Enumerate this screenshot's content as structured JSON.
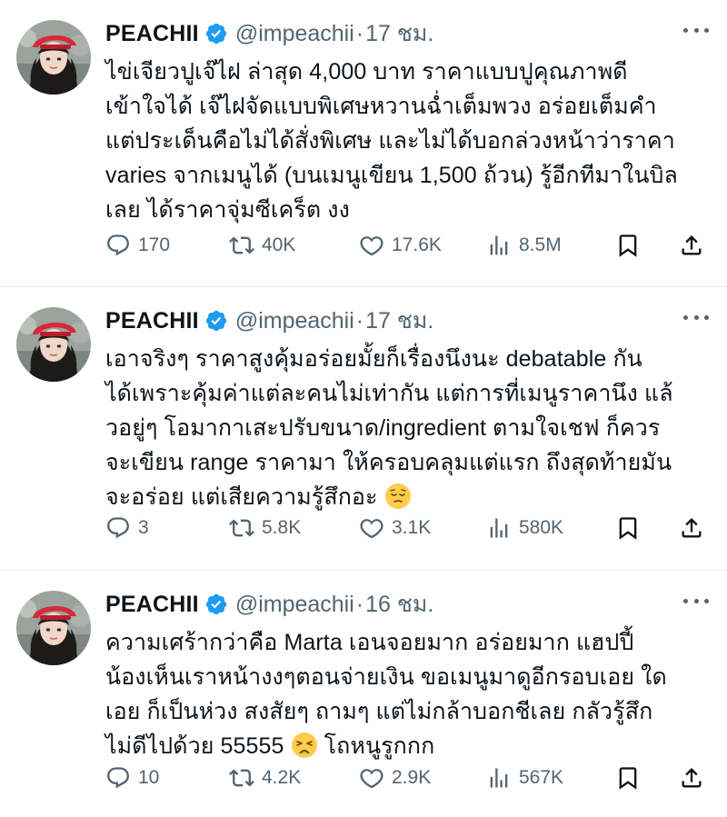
{
  "tweets": [
    {
      "name": "PEACHII",
      "handle": "@impeachii",
      "dot": "·",
      "time": "17 ชม.",
      "text": "ไข่เจียวปูเจ๊ไฝ ล่าสุด 4,000 บาท ราคาแบบปูคุณภาพดี\nเข้าใจได้ เจ๊ไฝจัดแบบพิเศษหวานฉ่ำเต็มพวง อร่อยเต็มคำ\nแต่ประเด็นคือไม่ได้สั่งพิเศษ และไม่ได้บอกล่วงหน้าว่าราคา\nvaries จากเมนูได้ (บนเมนูเขียน 1,500 ถ้วน) รู้อีกทีมาในบิล\nเลย ได้ราคาจุ่มซีเคร็ต งง",
      "replies": "170",
      "retweets": "40K",
      "likes": "17.6K",
      "views": "8.5M"
    },
    {
      "name": "PEACHII",
      "handle": "@impeachii",
      "dot": "·",
      "time": "17 ชม.",
      "text": "เอาจริงๆ ราคาสูงคุ้มอร่อยมั้ยก็เรื่องนึงนะ debatable กัน\nได้เพราะคุ้มค่าแต่ละคนไม่เท่ากัน แต่การที่เมนูราคานึง แล้\nวอยู่ๆ โอมากาเสะปรับขนาด/ingredient ตามใจเชฟ ก็ควร\nจะเขียน range ราคามา ให้ครอบคลุมแต่แรก ถึงสุดท้ายมัน\nจะอร่อย แต่เสียความรู้สึกอะ",
      "emoji": "pensive-face-emoji",
      "replies": "3",
      "retweets": "5.8K",
      "likes": "3.1K",
      "views": "580K"
    },
    {
      "name": "PEACHII",
      "handle": "@impeachii",
      "dot": "·",
      "time": "16 ชม.",
      "text_before_emoji": "ความเศร้ากว่าคือ Marta เอนจอยมาก อร่อยมาก แฮปปี้\nน้องเห็นเราหน้างงๆตอนจ่ายเงิน ขอเมนูมาดูอีกรอบเอย ใด\nเอย ก็เป็นห่วง สงสัยๆ ถามๆ แต่ไม่กล้าบอกชีเลย กลัวรู้สึก\nไม่ดีไปด้วย 55555",
      "emoji": "weary-face-emoji",
      "text_after_emoji": "โถหนูรูกกก",
      "replies": "10",
      "retweets": "4.2K",
      "likes": "2.9K",
      "views": "567K"
    }
  ],
  "colors": {
    "text": "#0f1419",
    "secondary": "#536471",
    "verified": "#1d9bf0",
    "divider": "#e6ecf0"
  },
  "icons": [
    "reply-icon",
    "retweet-icon",
    "like-icon",
    "views-icon",
    "bookmark-icon",
    "share-icon",
    "verified-badge-icon",
    "more-icon"
  ]
}
